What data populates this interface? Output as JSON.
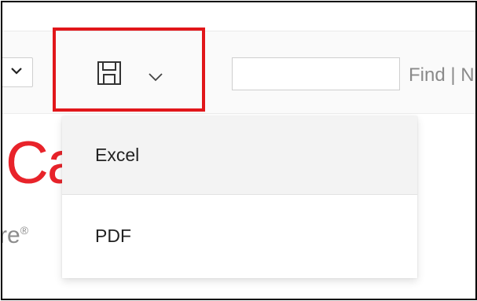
{
  "toolbar": {
    "search": {
      "value": "",
      "placeholder": ""
    },
    "find_links": "Find | N"
  },
  "brand": {
    "logo_fragment": "Ca",
    "subtitle_fragment": "re"
  },
  "export_menu": {
    "items": [
      {
        "label": "Excel"
      },
      {
        "label": "PDF"
      }
    ]
  },
  "colors": {
    "highlight": "#e1161a",
    "brand_red": "#e8232a",
    "muted_text": "#8a8a8a"
  },
  "icons": {
    "left_dropdown": "chevron-down-icon",
    "export": "save-icon",
    "export_chevron": "chevron-down-icon"
  }
}
